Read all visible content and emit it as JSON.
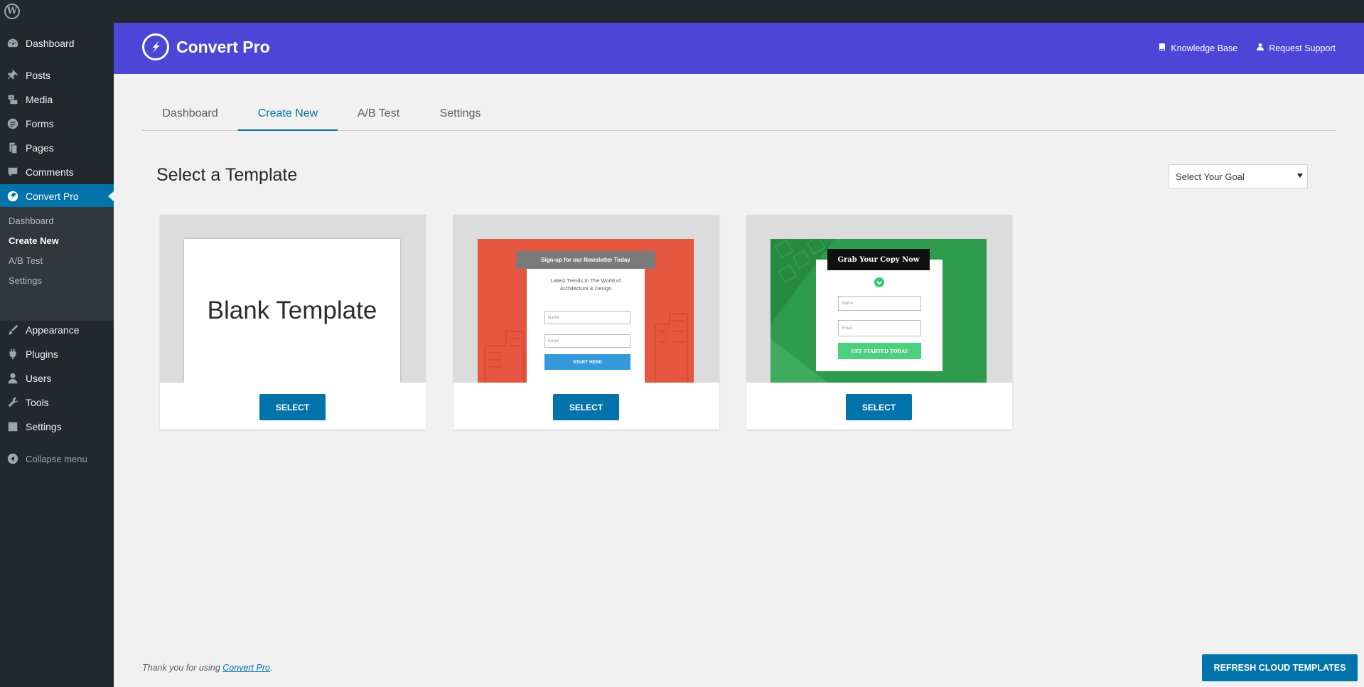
{
  "admin_bar": {
    "logo_icon": "wordpress-icon"
  },
  "sidebar": {
    "items": [
      {
        "label": "Dashboard",
        "icon": "dashboard-icon"
      },
      {
        "label": "Posts",
        "icon": "pin-icon"
      },
      {
        "label": "Media",
        "icon": "media-icon"
      },
      {
        "label": "Forms",
        "icon": "forms-icon"
      },
      {
        "label": "Pages",
        "icon": "pages-icon"
      },
      {
        "label": "Comments",
        "icon": "comment-icon"
      },
      {
        "label": "Convert Pro",
        "icon": "convert-pro-icon",
        "active": true
      },
      {
        "label": "Appearance",
        "icon": "brush-icon"
      },
      {
        "label": "Plugins",
        "icon": "plug-icon"
      },
      {
        "label": "Users",
        "icon": "user-icon"
      },
      {
        "label": "Tools",
        "icon": "wrench-icon"
      },
      {
        "label": "Settings",
        "icon": "settings-icon"
      }
    ],
    "submenu": [
      {
        "label": "Dashboard"
      },
      {
        "label": "Create New",
        "current": true
      },
      {
        "label": "A/B Test"
      },
      {
        "label": "Settings"
      }
    ],
    "collapse_label": "Collapse menu"
  },
  "header": {
    "brand": "Convert Pro",
    "knowledge_base": "Knowledge Base",
    "request_support": "Request Support",
    "color": "#4c46d8"
  },
  "tabs": [
    {
      "label": "Dashboard"
    },
    {
      "label": "Create New",
      "active": true
    },
    {
      "label": "A/B Test"
    },
    {
      "label": "Settings"
    }
  ],
  "main": {
    "title": "Select a Template",
    "goal_select": "Select Your Goal"
  },
  "templates": [
    {
      "name": "Blank Template",
      "button": "SELECT"
    },
    {
      "banner": "Sign-up for our Newsletter Today",
      "subtext_1": "Latest Trends In The World of",
      "subtext_2": "Architecture & Design",
      "name_placeholder": "Name",
      "email_placeholder": "Email",
      "cta": "START HERE",
      "button": "SELECT"
    },
    {
      "banner": "Grab Your Copy Now",
      "name_placeholder": "Name",
      "email_placeholder": "Email",
      "cta": "GET STARTED TODAY",
      "button": "SELECT"
    }
  ],
  "footer": {
    "thanks_prefix": "Thank you for using ",
    "link": "Convert Pro",
    "suffix": ".",
    "refresh_button": "REFRESH CLOUD TEMPLATES"
  },
  "colors": {
    "accent": "#0073aa",
    "sidebar": "#23282d",
    "red_template": "#e5553f",
    "green_template": "#2f9b4c"
  }
}
